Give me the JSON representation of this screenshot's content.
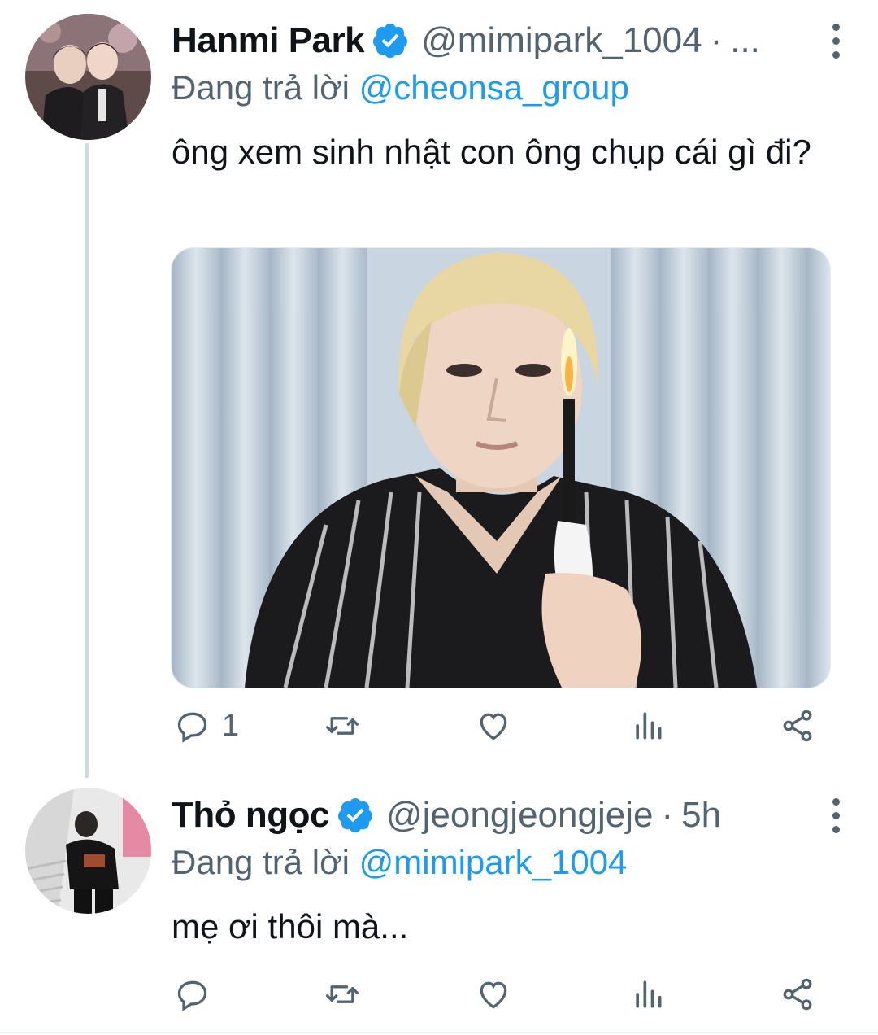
{
  "tweets": [
    {
      "name": "Hanmi Park",
      "handle": "@mimipark_1004",
      "separator": "·",
      "time": "...",
      "reply_prefix": "Đang trả lời",
      "reply_to": "@cheonsa_group",
      "text": "ông xem sinh nhật con ông chụp cái gì đi?",
      "verified": true,
      "has_media": true,
      "actions": {
        "reply_count": "1",
        "retweet_count": "",
        "like_count": ""
      }
    },
    {
      "name": "Thỏ ngọc",
      "handle": "@jeongjeongjeje",
      "separator": "·",
      "time": "5h",
      "reply_prefix": "Đang trả lời",
      "reply_to": "@mimipark_1004",
      "text": "mẹ ơi thôi mà...",
      "verified": true,
      "has_media": false,
      "actions": {
        "reply_count": "",
        "retweet_count": "",
        "like_count": ""
      }
    }
  ],
  "icons": {
    "verified": "verified-badge-icon",
    "more": "more-vertical-icon",
    "reply": "reply-icon",
    "retweet": "retweet-icon",
    "like": "heart-icon",
    "analytics": "analytics-icon",
    "share": "share-icon"
  },
  "colors": {
    "accent": "#1d9bf0",
    "secondary_text": "#536471",
    "thread_line": "#cfd9de"
  }
}
